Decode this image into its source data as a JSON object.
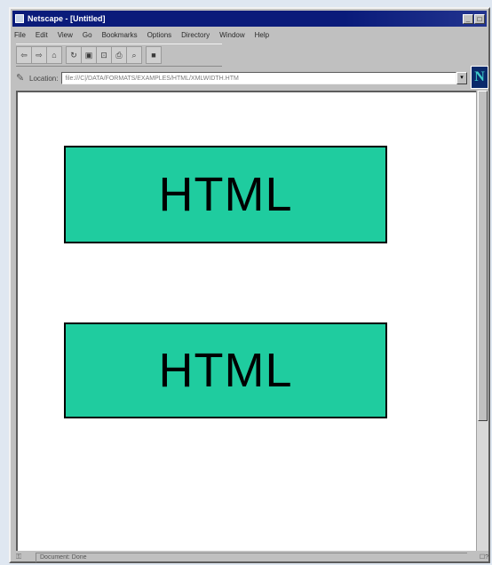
{
  "window": {
    "title": "Netscape - [Untitled]"
  },
  "menubar": {
    "items": [
      "File",
      "Edit",
      "View",
      "Go",
      "Bookmarks",
      "Options",
      "Directory",
      "Window",
      "Help"
    ]
  },
  "toolbar": {
    "buttons": [
      {
        "icon": "back-icon",
        "glyph": "⇦"
      },
      {
        "icon": "forward-icon",
        "glyph": "⇨"
      },
      {
        "icon": "home-icon",
        "glyph": "⌂"
      },
      {
        "icon": "reload-icon",
        "glyph": "↻"
      },
      {
        "icon": "images-icon",
        "glyph": "▣"
      },
      {
        "icon": "open-icon",
        "glyph": "⊡"
      },
      {
        "icon": "print-icon",
        "glyph": "⎙"
      },
      {
        "icon": "find-icon",
        "glyph": "⌕"
      },
      {
        "icon": "stop-icon",
        "glyph": "■"
      }
    ]
  },
  "location": {
    "label": "Location:",
    "url": "file:///C|/DATA/FORMATS/EXAMPLES/HTML/XMLWIDTH.HTM"
  },
  "throbber": {
    "logo": "N"
  },
  "content": {
    "boxes": [
      {
        "text": "HTML"
      },
      {
        "text": "HTML"
      }
    ]
  },
  "statusbar": {
    "text": "Document: Done",
    "right": "☐?"
  },
  "colors": {
    "titlebar": "#0a1b7a",
    "box_fill": "#1fcc9f",
    "chrome": "#c0c0c0"
  }
}
